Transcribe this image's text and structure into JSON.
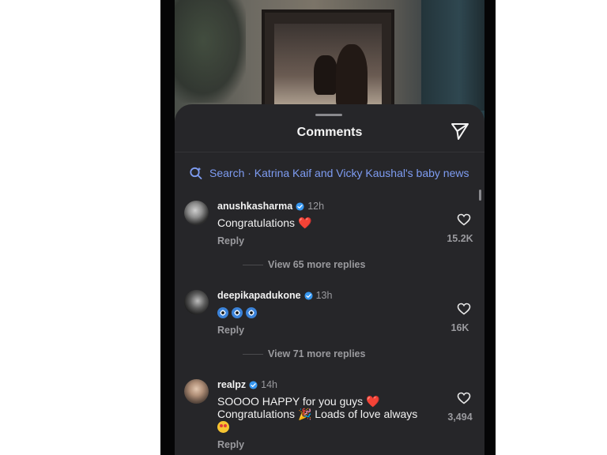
{
  "sheet": {
    "title": "Comments",
    "search_text": "Search · Katrina Kaif and Vicky Kaushal's baby news"
  },
  "comments": [
    {
      "username": "anushkasharma",
      "time": "12h",
      "text": "Congratulations",
      "emoji": "❤️",
      "reply_label": "Reply",
      "likes": "15.2K",
      "more_replies": "View 65 more replies"
    },
    {
      "username": "deepikapadukone",
      "time": "13h",
      "text": "🧿🧿🧿",
      "reply_label": "Reply",
      "likes": "16K",
      "more_replies": "View 71 more replies"
    },
    {
      "username": "realpz",
      "time": "14h",
      "text_line1": "SOOOO HAPPY for you guys",
      "text_line1_emoji": "❤️",
      "text_line2a": "Congratulations",
      "text_line2_emoji": "🎉",
      "text_line2b": " Loads of love always",
      "text_line3_emoji": "😍",
      "reply_label": "Reply",
      "likes": "3,494"
    }
  ],
  "icons": {
    "send": "paper-plane-icon",
    "search": "search-sparkle-icon",
    "like": "heart-outline-icon",
    "verified": "verified-badge-icon"
  },
  "colors": {
    "sheet_bg": "#262629",
    "search_accent": "#7e9cf2",
    "verified_blue": "#3797f0",
    "muted_text": "#9a9a9e"
  }
}
